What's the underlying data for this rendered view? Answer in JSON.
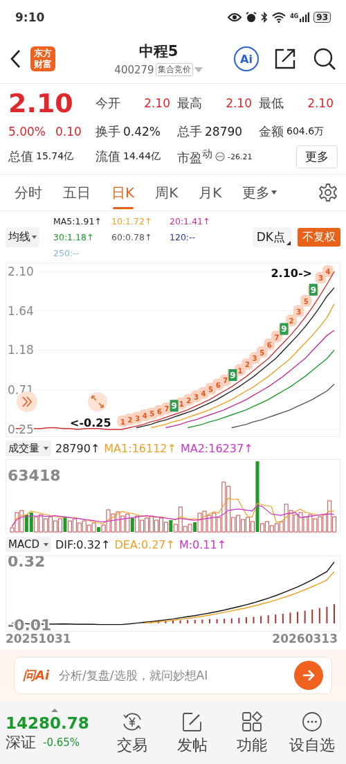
{
  "status_bar": {
    "time": "9:10",
    "network": "4G",
    "battery": "93"
  },
  "header": {
    "logo": "东方财富",
    "title": "中程5",
    "code": "400279",
    "session_tag": "集合竞价",
    "ai_button": "Ai"
  },
  "quote": {
    "price": "2.10",
    "change_pct": "5.00%",
    "change": "0.10",
    "more_button": "更多",
    "stats": [
      {
        "label": "今开",
        "value": "2.10",
        "up": true
      },
      {
        "label": "最高",
        "value": "2.10",
        "up": true
      },
      {
        "label": "最低",
        "value": "2.10",
        "up": true
      },
      {
        "label": "换手",
        "value": "0.42%",
        "up": false
      },
      {
        "label": "总手",
        "value": "28790",
        "up": false
      },
      {
        "label": "金额",
        "value": "604.6万",
        "up": false
      },
      {
        "label": "总值",
        "value": "15.74亿",
        "up": false
      },
      {
        "label": "流值",
        "value": "14.44亿",
        "up": false
      },
      {
        "label": "市盈$^{动}$",
        "value": "-26.21",
        "up": false,
        "kind": "pe"
      }
    ]
  },
  "tabs": [
    {
      "label": "分时",
      "selected": false
    },
    {
      "label": "五日",
      "selected": false
    },
    {
      "label": "日K",
      "selected": true
    },
    {
      "label": "周K",
      "selected": false
    },
    {
      "label": "月K",
      "selected": false
    },
    {
      "label": "更多",
      "selected": false,
      "kind": "dropdown"
    }
  ],
  "ma_bar": {
    "selector": "均线",
    "dk_button": "DK点",
    "adjust_button": "不复权",
    "values": [
      {
        "label": "MA5:1.91↑",
        "color": "#222222"
      },
      {
        "label": "10:1.72↑",
        "color": "#f0a020"
      },
      {
        "label": "20:1.41↑",
        "color": "#c0309a"
      },
      {
        "label": "30:1.18↑",
        "color": "#1a9a2a"
      },
      {
        "label": "60:0.78↑",
        "color": "#555555"
      },
      {
        "label": "120:--",
        "color": "#2a3a9a"
      },
      {
        "label": "250:--",
        "color": "#80b8e0"
      }
    ]
  },
  "price_chart": {
    "max_label": "2.10->",
    "min_label": "<-0.25",
    "sequence_marks": [
      {
        "label": "1",
        "kind": "count"
      },
      {
        "label": "2",
        "kind": "count"
      },
      {
        "label": "3",
        "kind": "count"
      },
      {
        "label": "4",
        "kind": "count"
      },
      {
        "label": "5",
        "kind": "count"
      },
      {
        "label": "6",
        "kind": "count"
      },
      {
        "label": "7",
        "kind": "count"
      },
      {
        "label": "9",
        "kind": "nine"
      },
      {
        "label": "1",
        "kind": "count"
      },
      {
        "label": "2",
        "kind": "count"
      },
      {
        "label": "3",
        "kind": "count"
      },
      {
        "label": "4",
        "kind": "count"
      },
      {
        "label": "5",
        "kind": "count"
      },
      {
        "label": "6",
        "kind": "count"
      },
      {
        "label": "7",
        "kind": "count"
      },
      {
        "label": "9",
        "kind": "nine"
      },
      {
        "label": "1",
        "kind": "count"
      },
      {
        "label": "2",
        "kind": "count"
      },
      {
        "label": "3",
        "kind": "count"
      },
      {
        "label": "5",
        "kind": "count"
      },
      {
        "label": "6",
        "kind": "count"
      },
      {
        "label": "7",
        "kind": "count"
      },
      {
        "label": "9",
        "kind": "nine"
      },
      {
        "label": "2",
        "kind": "count"
      },
      {
        "label": "3",
        "kind": "count"
      },
      {
        "label": "5",
        "kind": "count"
      },
      {
        "label": "9",
        "kind": "nine"
      },
      {
        "label": "3",
        "kind": "count"
      },
      {
        "label": "4",
        "kind": "count"
      }
    ],
    "chart_data": {
      "type": "line",
      "ylim": [
        0.25,
        2.1
      ],
      "grid": true,
      "yticks": [
        {
          "value": 2.1,
          "label": "2.10"
        },
        {
          "value": 1.64,
          "label": "1.64"
        },
        {
          "value": 1.18,
          "label": "1.18"
        },
        {
          "value": 0.71,
          "label": "0.71"
        },
        {
          "value": 0.25,
          "label": "0.25"
        }
      ],
      "series": [
        {
          "color": "#d03030",
          "values": [
            0.26,
            0.26,
            0.27,
            0.26,
            0.26,
            0.27,
            0.27,
            0.26,
            0.26,
            0.25,
            0.26,
            0.26,
            0.26,
            0.25,
            0.25,
            0.25,
            0.27,
            0.29,
            0.31,
            0.34,
            0.36,
            0.39,
            0.42,
            0.45,
            0.48,
            0.52,
            0.56,
            0.6,
            0.65,
            0.7,
            0.75,
            0.81,
            0.87,
            0.94,
            1.01,
            1.08,
            1.17,
            1.26,
            1.35,
            1.45,
            1.56,
            1.68,
            1.81,
            1.95,
            2.1
          ]
        },
        {
          "color": "#222222",
          "values": [
            null,
            null,
            null,
            null,
            null,
            null,
            null,
            null,
            null,
            null,
            null,
            null,
            null,
            null,
            null,
            null,
            null,
            0.27,
            0.29,
            0.31,
            0.34,
            0.36,
            0.39,
            0.42,
            0.45,
            0.48,
            0.52,
            0.56,
            0.6,
            0.65,
            0.7,
            0.75,
            0.81,
            0.87,
            0.94,
            1.01,
            1.08,
            1.17,
            1.26,
            1.35,
            1.45,
            1.56,
            1.68,
            1.81,
            1.91
          ]
        },
        {
          "color": "#f0a020",
          "values": [
            null,
            null,
            null,
            null,
            null,
            null,
            null,
            null,
            null,
            null,
            null,
            null,
            null,
            null,
            null,
            null,
            null,
            null,
            null,
            0.27,
            0.29,
            0.31,
            0.34,
            0.36,
            0.39,
            0.42,
            0.45,
            0.48,
            0.52,
            0.56,
            0.6,
            0.65,
            0.7,
            0.75,
            0.81,
            0.87,
            0.94,
            1.01,
            1.08,
            1.17,
            1.26,
            1.35,
            1.45,
            1.56,
            1.72
          ]
        },
        {
          "color": "#c0309a",
          "values": [
            null,
            null,
            null,
            null,
            null,
            null,
            null,
            null,
            null,
            null,
            null,
            null,
            null,
            null,
            null,
            null,
            null,
            null,
            null,
            null,
            null,
            0.27,
            0.29,
            0.31,
            0.34,
            0.36,
            0.39,
            0.42,
            0.45,
            0.48,
            0.52,
            0.56,
            0.6,
            0.65,
            0.7,
            0.75,
            0.81,
            0.87,
            0.94,
            1.01,
            1.08,
            1.17,
            1.26,
            1.35,
            1.41
          ]
        },
        {
          "color": "#1a9a2a",
          "values": [
            null,
            null,
            null,
            null,
            null,
            null,
            null,
            null,
            null,
            null,
            null,
            null,
            null,
            null,
            null,
            null,
            null,
            null,
            null,
            null,
            null,
            null,
            null,
            null,
            0.27,
            0.29,
            0.31,
            0.34,
            0.36,
            0.39,
            0.42,
            0.45,
            0.48,
            0.52,
            0.56,
            0.6,
            0.65,
            0.7,
            0.75,
            0.81,
            0.87,
            0.94,
            1.01,
            1.08,
            1.18
          ]
        },
        {
          "color": "#555555",
          "values": [
            null,
            null,
            null,
            null,
            null,
            null,
            null,
            null,
            null,
            null,
            null,
            null,
            null,
            null,
            null,
            null,
            null,
            null,
            null,
            null,
            null,
            null,
            null,
            null,
            null,
            null,
            null,
            null,
            null,
            null,
            0.27,
            0.29,
            0.31,
            0.34,
            0.36,
            0.39,
            0.42,
            0.45,
            0.48,
            0.52,
            0.56,
            0.6,
            0.65,
            0.7,
            0.78
          ]
        }
      ]
    }
  },
  "volume": {
    "selector": "成交量",
    "axis_label": "63418",
    "indicators": [
      {
        "label": "28790↑",
        "color": "#222222"
      },
      {
        "label": "MA1:16112↑",
        "color": "#f0a020"
      },
      {
        "label": "MA2:16237↑",
        "color": "#cc33cc"
      }
    ]
  },
  "macd": {
    "selector": "MACD",
    "indicators": [
      {
        "label": "DIF:0.32↑",
        "color": "#222222"
      },
      {
        "label": "DEA:0.27↑",
        "color": "#f0a020"
      },
      {
        "label": "M:0.11↑",
        "color": "#cc33cc"
      }
    ],
    "chart_data": {
      "type": "line",
      "ylim": [
        -0.04,
        0.35
      ],
      "yticks": [
        {
          "value": 0.32,
          "label": "0.32"
        },
        {
          "value": -0.01,
          "label": "-0.01"
        }
      ],
      "series": [
        {
          "color": "#111111",
          "values": [
            0,
            0,
            -0.002,
            -0.003,
            -0.004,
            -0.004,
            -0.004,
            -0.003,
            -0.004,
            -0.005,
            -0.005,
            -0.005,
            -0.006,
            -0.006,
            -0.006,
            -0.006,
            -0.003,
            0.001,
            0.005,
            0.009,
            0.013,
            0.018,
            0.023,
            0.029,
            0.035,
            0.04,
            0.047,
            0.054,
            0.061,
            0.069,
            0.078,
            0.087,
            0.097,
            0.107,
            0.119,
            0.131,
            0.144,
            0.159,
            0.174,
            0.19,
            0.208,
            0.227,
            0.248,
            0.27,
            0.32
          ]
        },
        {
          "color": "#f0a020",
          "values": [
            null,
            null,
            null,
            null,
            null,
            null,
            null,
            null,
            null,
            null,
            null,
            null,
            null,
            null,
            null,
            null,
            null,
            null,
            0.001,
            0.004,
            0.008,
            0.012,
            0.016,
            0.021,
            0.026,
            0.031,
            0.037,
            0.043,
            0.05,
            0.057,
            0.065,
            0.073,
            0.081,
            0.09,
            0.1,
            0.11,
            0.121,
            0.134,
            0.146,
            0.16,
            0.175,
            0.191,
            0.208,
            0.227,
            0.27
          ]
        }
      ]
    }
  },
  "dates": {
    "start": "20251031",
    "end": "20260313"
  },
  "ai_bar": {
    "logo": "问Ai",
    "placeholder": "分析/复盘/选股，就问妙想AI"
  },
  "bottom_nav": {
    "index_value": "14280.78",
    "index_name": "深证",
    "index_change": "-0.65%",
    "items": [
      {
        "label": "交易",
        "kind": "trade"
      },
      {
        "label": "发帖",
        "kind": "post"
      },
      {
        "label": "功能",
        "kind": "apps"
      },
      {
        "label": "设自选",
        "kind": "more"
      }
    ]
  }
}
